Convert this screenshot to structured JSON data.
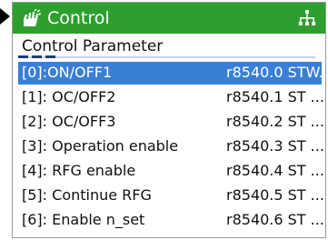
{
  "header": {
    "title": "Control",
    "icon": "hand-icon",
    "right_icon": "tree-icon",
    "color": "#2e9f2e"
  },
  "section": {
    "title": "Control Parameter"
  },
  "rows": [
    {
      "name": "[0]:ON/OFF1",
      "value": "r8540.0 STW.",
      "selected": true
    },
    {
      "name": "[1]: OC/OFF2",
      "value": "r8540.1 ST ..."
    },
    {
      "name": "[2]: OC/OFF3",
      "value": "r8540.2 ST ..."
    },
    {
      "name": "[3]: Operation enable",
      "value": "r8540.3 ST ..."
    },
    {
      "name": "[4]: RFG enable",
      "value": "r8540.4 ST ..."
    },
    {
      "name": "[5]: Continue RFG",
      "value": "r8540.5 ST ..."
    },
    {
      "name": "[6]: Enable n_set",
      "value": "r8540.6 ST ..."
    }
  ],
  "colors": {
    "selection": "#3a7fd6",
    "accent": "#1f3a8c"
  }
}
